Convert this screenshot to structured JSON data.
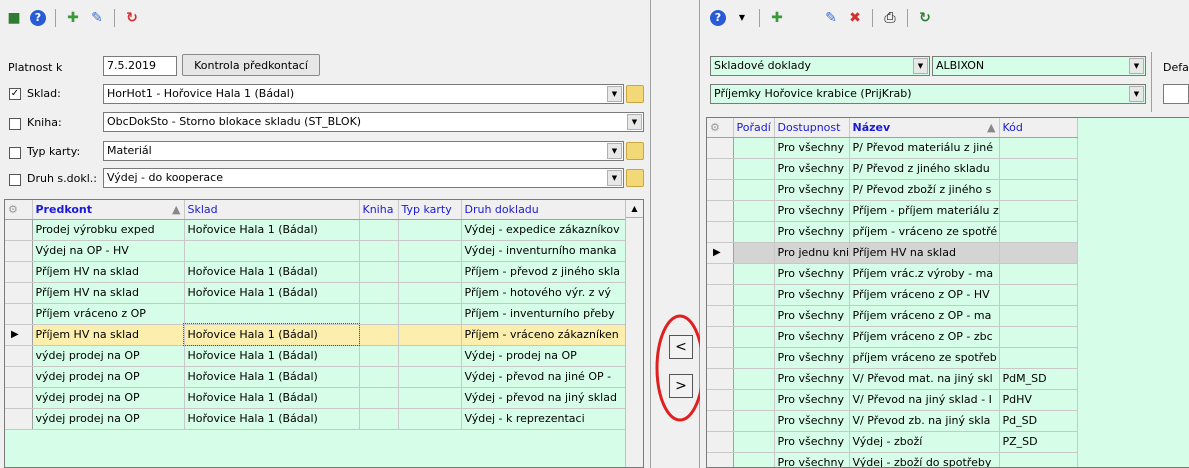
{
  "left": {
    "platnost": {
      "label": "Platnost k",
      "value": "7.5.2019",
      "button": "Kontrola předkontací"
    },
    "sklad": {
      "label": "Sklad:",
      "checked": true,
      "value": "HorHot1 - Hořovice Hala 1 (Bádal)"
    },
    "kniha": {
      "label": "Kniha:",
      "checked": false,
      "value": "ObcDokSto - Storno blokace skladu (ST_BLOK)"
    },
    "typ_karty": {
      "label": "Typ karty:",
      "checked": false,
      "value": "Materiál"
    },
    "druh": {
      "label": "Druh s.dokl.:",
      "checked": false,
      "value": "Výdej - do kooperace"
    },
    "grid": {
      "headers": {
        "predkont": "Predkont",
        "sklad": "Sklad",
        "kniha": "Kniha",
        "typ": "Typ karty",
        "druh": "Druh dokladu"
      },
      "rows": [
        {
          "predkont": "Prodej výrobku exped",
          "sklad": "Hořovice Hala 1 (Bádal)",
          "kniha": "",
          "typ": "",
          "druh": "Výdej - expedice zákazníkov"
        },
        {
          "predkont": "Výdej na OP - HV",
          "sklad": "",
          "kniha": "",
          "typ": "",
          "druh": "Výdej - inventurního manka"
        },
        {
          "predkont": "Příjem HV na sklad",
          "sklad": "Hořovice Hala 1 (Bádal)",
          "kniha": "",
          "typ": "",
          "druh": "Příjem - převod z jiného skla"
        },
        {
          "predkont": "Příjem HV na sklad",
          "sklad": "Hořovice Hala 1 (Bádal)",
          "kniha": "",
          "typ": "",
          "druh": "Příjem - hotového výr. z vý"
        },
        {
          "predkont": "Příjem vráceno z OP",
          "sklad": "",
          "kniha": "",
          "typ": "",
          "druh": "Příjem - inventurního přeby"
        },
        {
          "predkont": "Příjem HV na sklad",
          "sklad": "Hořovice Hala 1 (Bádal)",
          "kniha": "",
          "typ": "",
          "druh": "Příjem - vráceno zákazníken"
        },
        {
          "predkont": "výdej prodej na OP",
          "sklad": "Hořovice Hala 1 (Bádal)",
          "kniha": "",
          "typ": "",
          "druh": "Výdej - prodej na OP"
        },
        {
          "predkont": "výdej prodej na OP",
          "sklad": "Hořovice Hala 1 (Bádal)",
          "kniha": "",
          "typ": "",
          "druh": "Výdej - převod na jiné OP -"
        },
        {
          "predkont": "výdej prodej na OP",
          "sklad": "Hořovice Hala 1 (Bádal)",
          "kniha": "",
          "typ": "",
          "druh": "Výdej - převod na jiný sklad"
        },
        {
          "predkont": "výdej prodej na OP",
          "sklad": "Hořovice Hala 1 (Bádal)",
          "kniha": "",
          "typ": "",
          "druh": "Výdej - k reprezentaci"
        }
      ]
    }
  },
  "mid": {
    "left_arrow": "<",
    "right_arrow": ">"
  },
  "right": {
    "select1": "Skladové doklady",
    "select2": "ALBIXON",
    "select3": "Příjemky Hořovice krabice (PrijKrab)",
    "defa_label": "Defa",
    "grid": {
      "headers": {
        "poradi": "Pořadí",
        "dostupnost": "Dostupnost",
        "nazev": "Název",
        "kod": "Kód"
      },
      "rows": [
        {
          "dostupnost": "Pro všechny",
          "nazev": "P/ Převod materiálu z jiné",
          "kod": ""
        },
        {
          "dostupnost": "Pro všechny",
          "nazev": "P/ Převod z jiného skladu",
          "kod": ""
        },
        {
          "dostupnost": "Pro všechny",
          "nazev": "P/ Převod zboží z jiného s",
          "kod": ""
        },
        {
          "dostupnost": "Pro všechny",
          "nazev": "Příjem - příjem materiálu z",
          "kod": ""
        },
        {
          "dostupnost": "Pro všechny",
          "nazev": "příjem - vráceno ze spotřé",
          "kod": ""
        },
        {
          "dostupnost": "Pro jednu kni",
          "nazev": "Příjem HV na sklad",
          "kod": ""
        },
        {
          "dostupnost": "Pro všechny",
          "nazev": "Příjem vrác.z výroby - ma",
          "kod": ""
        },
        {
          "dostupnost": "Pro všechny",
          "nazev": "Příjem vráceno z OP - HV",
          "kod": ""
        },
        {
          "dostupnost": "Pro všechny",
          "nazev": "Příjem vráceno z OP - ma",
          "kod": ""
        },
        {
          "dostupnost": "Pro všechny",
          "nazev": "Příjem vráceno z OP - zbc",
          "kod": ""
        },
        {
          "dostupnost": "Pro všechny",
          "nazev": "příjem vráceno ze spotřeb",
          "kod": ""
        },
        {
          "dostupnost": "Pro všechny",
          "nazev": "V/ Převod mat. na jiný skl",
          "kod": "PdM_SD"
        },
        {
          "dostupnost": "Pro všechny",
          "nazev": "V/ Převod na jiný sklad - I",
          "kod": "PdHV"
        },
        {
          "dostupnost": "Pro všechny",
          "nazev": "V/ Převod zb. na jiný skla",
          "kod": "Pd_SD"
        },
        {
          "dostupnost": "Pro všechny",
          "nazev": "Výdej - zboží",
          "kod": "PZ_SD"
        },
        {
          "dostupnost": "Pro všechny",
          "nazev": "Výdej - zboží do spotřeby",
          "kod": ""
        }
      ]
    }
  }
}
